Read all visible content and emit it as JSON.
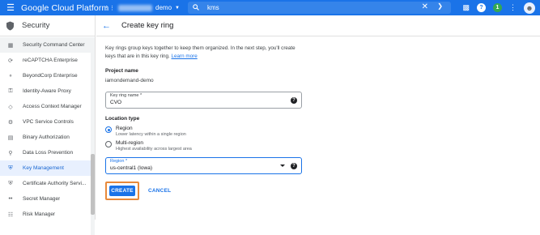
{
  "topbar": {
    "brand": "Google Cloud Platform",
    "project_suffix": "demo",
    "search_query": "kms",
    "badge_count": "1"
  },
  "sidebar": {
    "title": "Security",
    "items": [
      {
        "label": "Security Command Center",
        "icon": "grid-icon"
      },
      {
        "label": "reCAPTCHA Enterprise",
        "icon": "recaptcha-icon"
      },
      {
        "label": "BeyondCorp Enterprise",
        "icon": "beyondcorp-icon"
      },
      {
        "label": "Identity-Aware Proxy",
        "icon": "proxy-icon"
      },
      {
        "label": "Access Context Manager",
        "icon": "diamond-icon"
      },
      {
        "label": "VPC Service Controls",
        "icon": "vpc-icon"
      },
      {
        "label": "Binary Authorization",
        "icon": "binary-icon"
      },
      {
        "label": "Data Loss Prevention",
        "icon": "dlp-icon"
      },
      {
        "label": "Key Management",
        "icon": "key-shield-icon"
      },
      {
        "label": "Certificate Authority Servi...",
        "icon": "certificate-icon"
      },
      {
        "label": "Secret Manager",
        "icon": "secret-icon"
      },
      {
        "label": "Risk Manager",
        "icon": "risk-icon"
      }
    ],
    "active_index": 8
  },
  "page": {
    "title": "Create key ring",
    "description": "Key rings group keys together to keep them organized. In the next step, you'll create keys that are in this key ring.",
    "learn_more": "Learn more",
    "project_name_label": "Project name",
    "project_name_value": "iamondemand-demo",
    "key_ring_name_label": "Key ring name *",
    "key_ring_name_value": "CVO",
    "location_type_label": "Location type",
    "region_option": {
      "title": "Region",
      "subtitle": "Lower latency within a single region",
      "selected": true
    },
    "multiregion_option": {
      "title": "Multi-region",
      "subtitle": "Highest availability across largest area",
      "selected": false
    },
    "region_field_label": "Region *",
    "region_field_value": "us-central1 (Iowa)",
    "create_button": "CREATE",
    "cancel_button": "CANCEL"
  },
  "colors": {
    "accent": "#1a73e8",
    "highlight_outline": "#e8893a"
  }
}
